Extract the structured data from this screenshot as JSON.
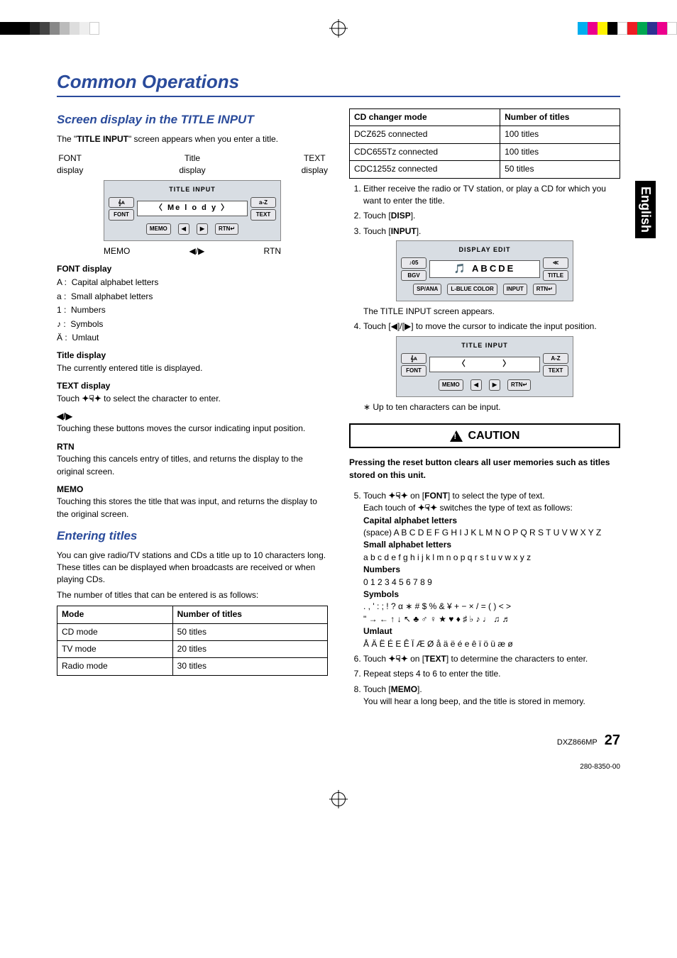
{
  "section_title": "Common Operations",
  "side_tab": "English",
  "left": {
    "h_screen": "Screen display in the TITLE INPUT",
    "screen_intro_pre": "The \"",
    "screen_intro_bold": "TITLE INPUT",
    "screen_intro_post": "\" screen appears when you enter a title.",
    "labels_top": {
      "font": "FONT display",
      "title": "Title display",
      "text": "TEXT display"
    },
    "labels_top_short": {
      "font": "FONT",
      "title": "Title",
      "text": "TEXT",
      "sub": "display"
    },
    "shot1": {
      "title": "TITLE INPUT",
      "left_btn1": "𝄞ᴀ",
      "left_btn2": "FONT",
      "center_text": "Me l o d y",
      "right_btn1": "a-Z",
      "right_btn2": "TEXT",
      "bottom": [
        "MEMO",
        "◀",
        "▶",
        "RTN↵"
      ]
    },
    "labels_bottom": {
      "memo": "MEMO",
      "arrows": "◀/▶",
      "rtn": "RTN"
    },
    "font_display_head": "FONT display",
    "font_items": [
      {
        "k": "A :",
        "v": "Capital alphabet letters"
      },
      {
        "k": "a :",
        "v": "Small alphabet letters"
      },
      {
        "k": "1 :",
        "v": "Numbers"
      },
      {
        "k": "♪ :",
        "v": "Symbols"
      },
      {
        "k": "Ä :",
        "v": "Umlaut"
      }
    ],
    "title_display_head": "Title display",
    "title_display_body": "The currently entered title is displayed.",
    "text_display_head": "TEXT display",
    "text_display_body_pre": "Touch ",
    "text_display_body_post": " to select the character to enter.",
    "arrows_head": "◀/▶",
    "arrows_body": "Touching these buttons moves the cursor indicating input position.",
    "rtn_head": "RTN",
    "rtn_body": "Touching this cancels entry of titles, and returns the display to the original screen.",
    "memo_head": "MEMO",
    "memo_body": "Touching this stores the title that was input, and returns the display to the original screen.",
    "h_enter": "Entering titles",
    "enter_p1": "You can give radio/TV stations and CDs a title up to 10 characters long. These titles can be displayed when broadcasts are received or when playing CDs.",
    "enter_p2": "The number of titles that can be entered is as follows:",
    "table1_head": [
      "Mode",
      "Number of titles"
    ],
    "table1_rows": [
      [
        "CD mode",
        "50 titles"
      ],
      [
        "TV mode",
        "20 titles"
      ],
      [
        "Radio mode",
        "30 titles"
      ]
    ]
  },
  "right": {
    "table2_head": [
      "CD changer mode",
      "Number of titles"
    ],
    "table2_rows": [
      [
        "DCZ625 connected",
        "100 titles"
      ],
      [
        "CDC655Tz connected",
        "100 titles"
      ],
      [
        "CDC1255z connected",
        "50 titles"
      ]
    ],
    "step1": "Either receive the radio or TV station, or play a CD for which you want to enter the title.",
    "step2_pre": "Touch [",
    "step2_bold": "DISP",
    "step2_post": "].",
    "step3_pre": "Touch [",
    "step3_bold": "INPUT",
    "step3_post": "].",
    "shot2": {
      "title": "DISPLAY EDIT",
      "left1": "♪05",
      "left2": "BGV",
      "center": "ABCDE",
      "right1": "≪",
      "right2": "TITLE",
      "bottom": [
        "SP/ANA",
        "L-BLUE COLOR",
        "INPUT",
        "RTN↵"
      ]
    },
    "after_shot2": "The TITLE INPUT screen appears.",
    "step4_pre": "Touch [",
    "step4_mid": "]/[",
    "step4_post": "] to move the cursor to indicate the input position.",
    "shot3": {
      "title": "TITLE INPUT",
      "left1": "𝄞ᴀ",
      "left2": "FONT",
      "center": "",
      "right1": "A-Z",
      "right2": "TEXT",
      "bottom": [
        "MEMO",
        "◀",
        "▶",
        "RTN↵"
      ]
    },
    "note_upto10": "∗ Up to ten characters can be input.",
    "caution_label": "CAUTION",
    "caution_body": "Pressing the reset button clears all user memories such as titles stored on this unit.",
    "step5_pre": "Touch ",
    "step5_mid": " on [",
    "step5_bold": "FONT",
    "step5_post": "] to select the type of text.",
    "step5_line2_pre": "Each touch of ",
    "step5_line2_post": " switches the type of text as follows:",
    "cap_head": "Capital alphabet letters",
    "cap_body": "(space) A B C D E F G H I J K L M N O P Q R S T U V W X Y Z",
    "small_head": "Small alphabet letters",
    "small_body": "a b c d e f g h i j k l m n o p q r s t u v w x y z",
    "num_head": "Numbers",
    "num_body": "0 1 2 3 4 5 6 7 8 9",
    "sym_head": "Symbols",
    "sym_body1": ". , ' : ; ! ? α ∗ # $ % & ¥ + − × / = ( ) < >",
    "sym_body2": "\" → ← ↑ ↓ ↖ ♣ ♂ ♀ ★ ♥ ♦ ♯ ♭ ♪ ♩ ♫ ♬",
    "uml_head": "Umlaut",
    "uml_body": "Å Ä Ë É E Ê Ï Æ Ø å ä ë é e ê ï ö ü æ ø",
    "step6_pre": "Touch ",
    "step6_mid": " on [",
    "step6_bold": "TEXT",
    "step6_post": "] to determine the characters to enter.",
    "step7": "Repeat steps 4 to 6 to enter the title.",
    "step8_pre": "Touch [",
    "step8_bold": "MEMO",
    "step8_post": "].",
    "step8_body": "You will hear a long beep, and the title is stored in memory."
  },
  "footer_model": "DXZ866MP",
  "footer_page": "27",
  "part_no": "280-8350-00",
  "touch_glyph": "✦☟✦"
}
